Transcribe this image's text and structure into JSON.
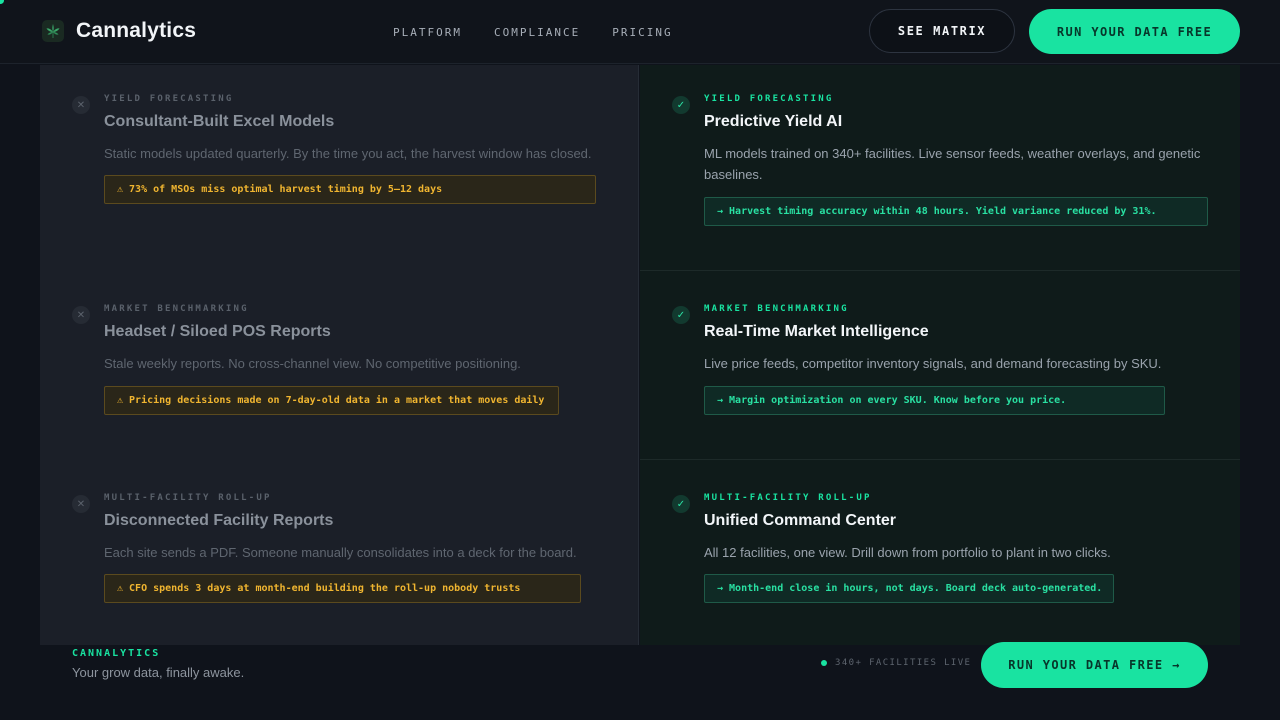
{
  "header": {
    "brand": "Cannalytics",
    "nav": [
      "PLATFORM",
      "COMPLIANCE",
      "PRICING"
    ],
    "see_matrix": "SEE MATRIX",
    "cta": "RUN YOUR DATA FREE"
  },
  "rows": [
    {
      "left": {
        "eyebrow": "YIELD FORECASTING",
        "title": "Consultant-Built Excel Models",
        "desc": "Static models updated quarterly. By the time you act, the harvest window has closed.",
        "note": "⚠ 73% of MSOs miss optimal harvest timing by 5–12 days"
      },
      "right": {
        "eyebrow": "YIELD FORECASTING",
        "title": "Predictive Yield AI",
        "desc": "ML models trained on 340+ facilities. Live sensor feeds, weather overlays, and genetic baselines.",
        "note": "→ Harvest timing accuracy within 48 hours. Yield variance reduced by 31%."
      }
    },
    {
      "left": {
        "eyebrow": "MARKET BENCHMARKING",
        "title": "Headset / Siloed POS Reports",
        "desc": "Stale weekly reports. No cross-channel view. No competitive positioning.",
        "note": "⚠ Pricing decisions made on 7-day-old data in a market that moves daily"
      },
      "right": {
        "eyebrow": "MARKET BENCHMARKING",
        "title": "Real-Time Market Intelligence",
        "desc": "Live price feeds, competitor inventory signals, and demand forecasting by SKU.",
        "note": "→ Margin optimization on every SKU. Know before you price."
      }
    },
    {
      "left": {
        "eyebrow": "MULTI-FACILITY ROLL-UP",
        "title": "Disconnected Facility Reports",
        "desc": "Each site sends a PDF. Someone manually consolidates into a deck for the board.",
        "note": "⚠ CFO spends 3 days at month-end building the roll-up nobody trusts"
      },
      "right": {
        "eyebrow": "MULTI-FACILITY ROLL-UP",
        "title": "Unified Command Center",
        "desc": "All 12 facilities, one view. Drill down from portfolio to plant in two clicks.",
        "note": "→ Month-end close in hours, not days. Board deck auto-generated."
      }
    }
  ],
  "footer": {
    "brand": "CANNALYTICS",
    "tagline": "Your grow data, finally awake.",
    "status": "340+ FACILITIES LIVE",
    "cta": "RUN YOUR DATA FREE →"
  },
  "icons": {
    "logo": "cannabis-leaf-icon",
    "left_mark": "x-icon",
    "right_mark": "check-icon"
  },
  "colors": {
    "accent": "#19e3a1",
    "warning": "#f0b530",
    "background": "#0f131b"
  }
}
